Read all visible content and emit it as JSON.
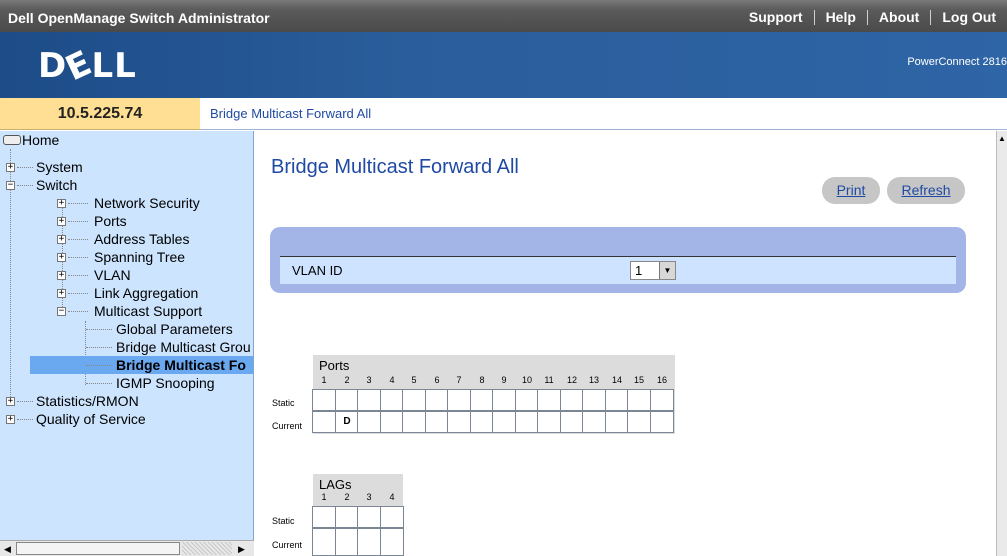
{
  "topbar": {
    "title": "Dell OpenManage Switch Administrator",
    "links": [
      "Support",
      "Help",
      "About",
      "Log Out"
    ]
  },
  "brand": {
    "logo": "DELL",
    "product": "PowerConnect 2816"
  },
  "address": {
    "ip": "10.5.225.74",
    "breadcrumb": "Bridge Multicast Forward All"
  },
  "tree": {
    "home": "Home",
    "system": "System",
    "switch": "Switch",
    "switch_children": [
      "Network Security",
      "Ports",
      "Address Tables",
      "Spanning Tree",
      "VLAN",
      "Link Aggregation",
      "Multicast Support"
    ],
    "multicast_children": [
      "Global Parameters",
      "Bridge Multicast Grou",
      "Bridge Multicast Fo",
      "IGMP Snooping"
    ],
    "after": [
      "Statistics/RMON",
      "Quality of Service"
    ]
  },
  "page": {
    "title": "Bridge Multicast Forward All",
    "print": "Print",
    "refresh": "Refresh",
    "vlan_label": "VLAN ID",
    "vlan_value": "1"
  },
  "ports": {
    "header": "Ports",
    "columns": [
      "1",
      "2",
      "3",
      "4",
      "5",
      "6",
      "7",
      "8",
      "9",
      "10",
      "11",
      "12",
      "13",
      "14",
      "15",
      "16"
    ],
    "static_label": "Static",
    "current_label": "Current",
    "static_values": [
      "",
      "",
      "",
      "",
      "",
      "",
      "",
      "",
      "",
      "",
      "",
      "",
      "",
      "",
      "",
      ""
    ],
    "current_values": [
      "",
      "D",
      "",
      "",
      "",
      "",
      "",
      "",
      "",
      "",
      "",
      "",
      "",
      "",
      "",
      ""
    ]
  },
  "lags": {
    "header": "LAGs",
    "columns": [
      "1",
      "2",
      "3",
      "4"
    ],
    "static_label": "Static",
    "current_label": "Current"
  }
}
